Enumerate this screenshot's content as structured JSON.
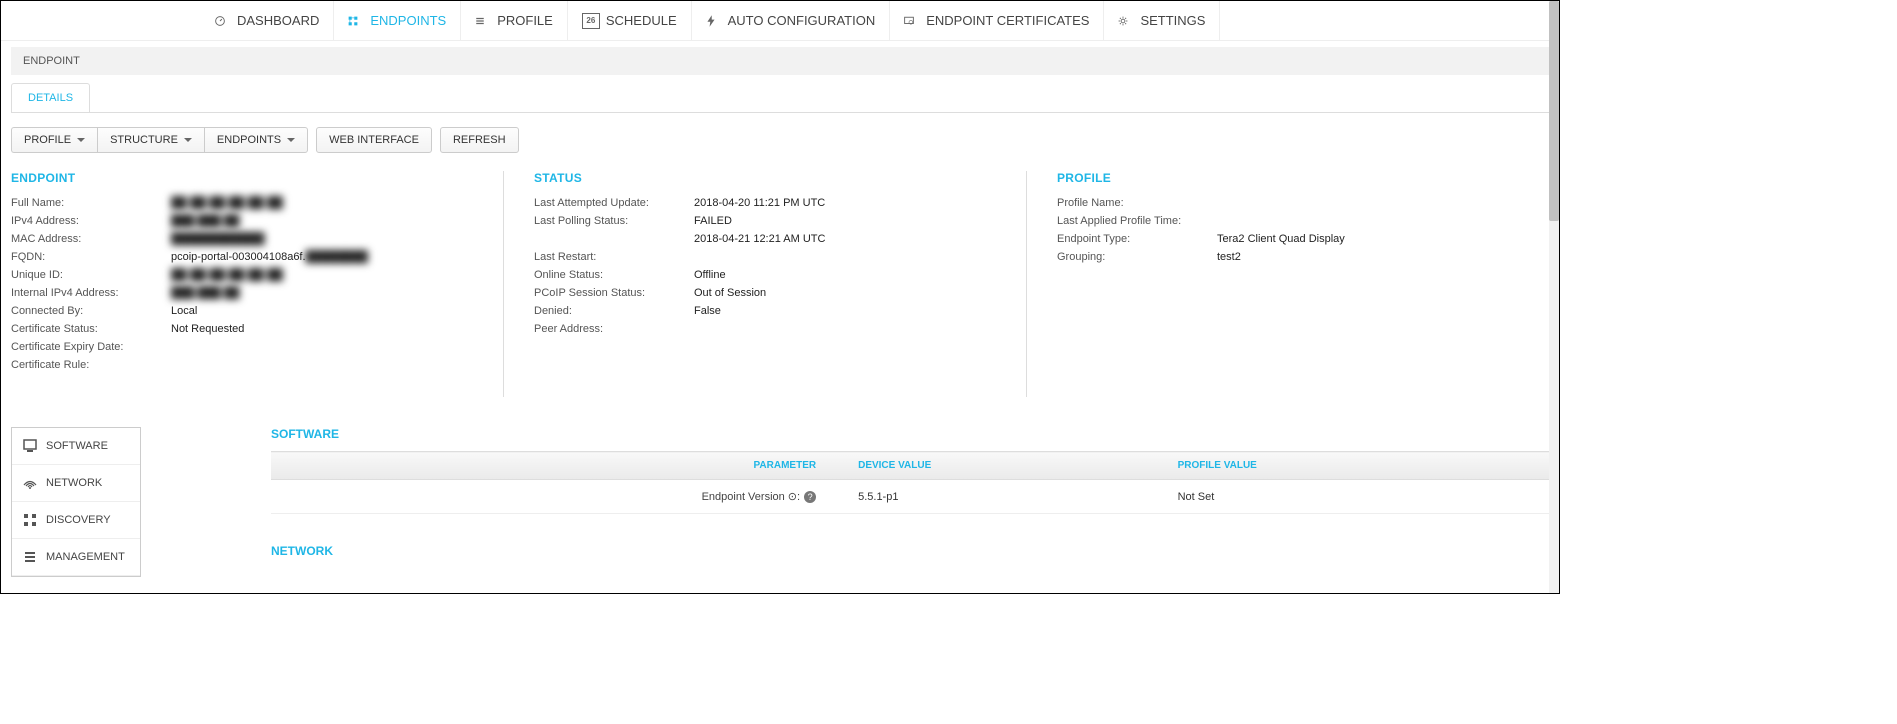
{
  "topnav": {
    "items": [
      {
        "label": "DASHBOARD",
        "icon": "dashboard-icon"
      },
      {
        "label": "ENDPOINTS",
        "icon": "endpoints-icon",
        "active": true
      },
      {
        "label": "PROFILE",
        "icon": "profile-icon"
      },
      {
        "label": "SCHEDULE",
        "icon": "schedule-icon",
        "badge": "26"
      },
      {
        "label": "AUTO CONFIGURATION",
        "icon": "bolt-icon"
      },
      {
        "label": "ENDPOINT CERTIFICATES",
        "icon": "certificate-icon"
      },
      {
        "label": "SETTINGS",
        "icon": "gear-icon"
      }
    ]
  },
  "breadcrumb": {
    "text": "ENDPOINT"
  },
  "tabs": [
    {
      "label": "DETAILS",
      "active": true
    }
  ],
  "toolbar": {
    "group": [
      {
        "label": "PROFILE"
      },
      {
        "label": "STRUCTURE"
      },
      {
        "label": "ENDPOINTS"
      }
    ],
    "web_interface": "WEB INTERFACE",
    "refresh": "REFRESH"
  },
  "endpoint_section": {
    "title": "ENDPOINT",
    "rows": [
      {
        "k": "Full Name:",
        "v": "██-██-██-██-██-██",
        "blur": true
      },
      {
        "k": "IPv4 Address:",
        "v": "███.███.██",
        "blur": true
      },
      {
        "k": "MAC Address:",
        "v": "████████████",
        "blur": true
      },
      {
        "k": "FQDN:",
        "v": "pcoip-portal-003004108a6f.████████",
        "partial_blur": true
      },
      {
        "k": "Unique ID:",
        "v": "██-██-██-██-██-██",
        "blur": true
      },
      {
        "k": "Internal IPv4 Address:",
        "v": "███.███.██",
        "blur": true
      },
      {
        "k": "Connected By:",
        "v": "Local"
      },
      {
        "k": "Certificate Status:",
        "v": "Not Requested"
      },
      {
        "k": "Certificate Expiry Date:",
        "v": ""
      },
      {
        "k": "Certificate Rule:",
        "v": ""
      }
    ]
  },
  "status_section": {
    "title": "STATUS",
    "rows": [
      {
        "k": "Last Attempted Update:",
        "v": "2018-04-20 11:21 PM UTC"
      },
      {
        "k": "Last Polling Status:",
        "v": "FAILED"
      },
      {
        "k": "",
        "v": "2018-04-21 12:21 AM UTC"
      },
      {
        "k": "Last Restart:",
        "v": ""
      },
      {
        "k": "Online Status:",
        "v": "Offline"
      },
      {
        "k": "PCoIP Session Status:",
        "v": "Out of Session"
      },
      {
        "k": "Denied:",
        "v": "False"
      },
      {
        "k": "Peer Address:",
        "v": ""
      }
    ]
  },
  "profile_section": {
    "title": "PROFILE",
    "rows": [
      {
        "k": "Profile Name:",
        "v": ""
      },
      {
        "k": "Last Applied Profile Time:",
        "v": ""
      },
      {
        "k": "Endpoint Type:",
        "v": "Tera2 Client Quad Display"
      },
      {
        "k": "Grouping:",
        "v": "test2"
      }
    ]
  },
  "sidenav": {
    "items": [
      {
        "label": "SOFTWARE",
        "icon": "software-icon",
        "active": true
      },
      {
        "label": "NETWORK",
        "icon": "network-icon"
      },
      {
        "label": "DISCOVERY",
        "icon": "discovery-icon"
      },
      {
        "label": "MANAGEMENT",
        "icon": "management-icon"
      }
    ]
  },
  "software_panel": {
    "title": "SOFTWARE",
    "columns": {
      "c1": "PARAMETER",
      "c2": "DEVICE VALUE",
      "c3": "PROFILE VALUE"
    },
    "row": {
      "param": "Endpoint Version ⊙:",
      "device_value": "5.5.1-p1",
      "profile_value": "Not Set"
    }
  },
  "network_panel": {
    "title": "NETWORK"
  }
}
